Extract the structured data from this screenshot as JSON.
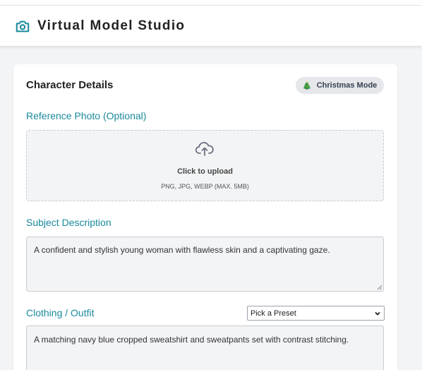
{
  "app": {
    "title": "Virtual Model Studio",
    "logo_icon": "camera-icon",
    "accent": "#1a8a9c"
  },
  "card": {
    "title": "Character Details",
    "badge": {
      "icon": "christmas-tree-icon",
      "label": "Christmas Mode"
    }
  },
  "reference_photo": {
    "label": "Reference Photo (Optional)",
    "upload_icon": "cloud-upload-icon",
    "upload_title": "Click to upload",
    "upload_hint": "PNG, JPG, WEBP (MAX. 5MB)"
  },
  "subject": {
    "label": "Subject Description",
    "value": "A confident and stylish young woman with flawless skin and a captivating gaze."
  },
  "clothing": {
    "label": "Clothing / Outfit",
    "preset_selected": "Pick a Preset",
    "value": "A matching navy blue cropped sweatshirt and sweatpants set with contrast stitching."
  }
}
